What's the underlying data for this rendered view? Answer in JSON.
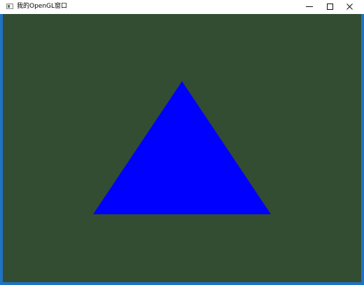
{
  "window": {
    "title": "我的OpenGL窗口",
    "buttons": {
      "minimize": "minimize",
      "maximize": "maximize",
      "close": "close"
    }
  },
  "colors": {
    "titlebar": "#ffffff",
    "frame": "#1f73c4",
    "clear_color": "#334d33",
    "triangle_fill": "#0000ff"
  },
  "scene": {
    "shape": "triangle"
  }
}
